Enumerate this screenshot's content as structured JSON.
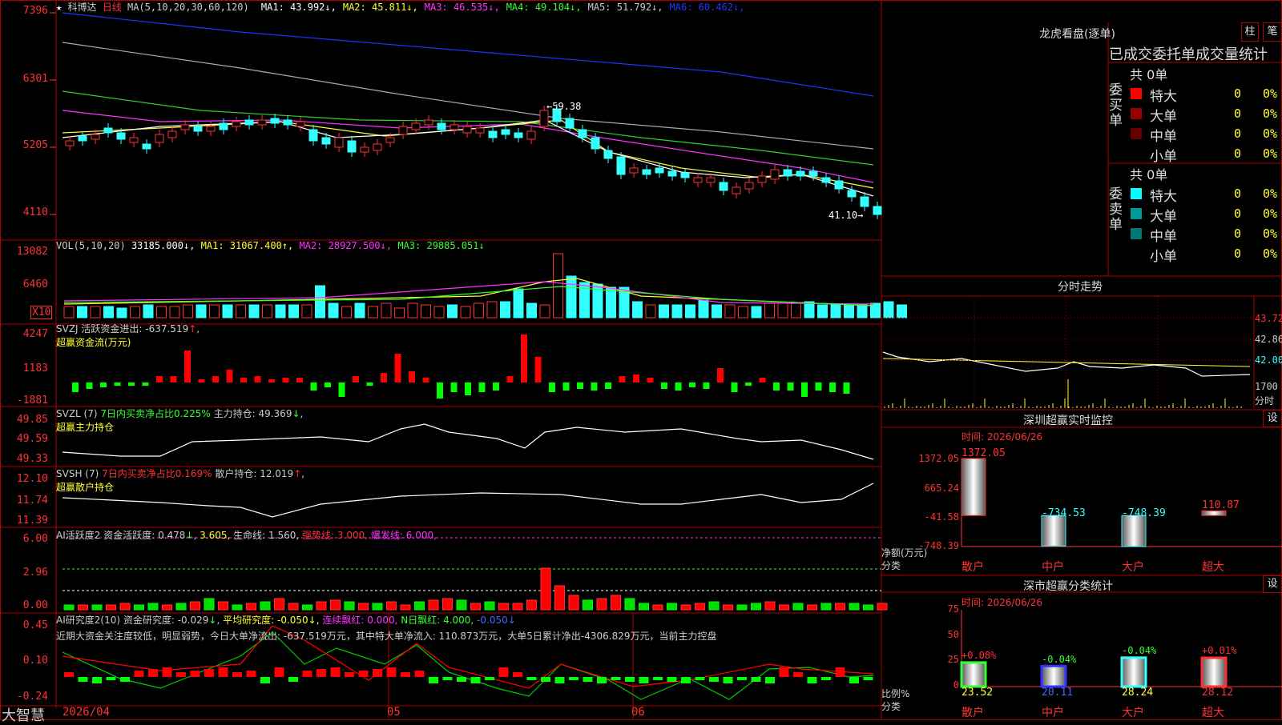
{
  "header": {
    "star": "★",
    "stock_name": "科博达",
    "period": "日线",
    "ma_label": "MA(5,10,20,30,60,120)",
    "ma": [
      {
        "label": "MA1:",
        "value": "43.992",
        "dir": "↓",
        "color": "#ffffff"
      },
      {
        "label": "MA2:",
        "value": "45.811",
        "dir": "↓",
        "color": "#ffff33"
      },
      {
        "label": "MA3:",
        "value": "46.535",
        "dir": "↓",
        "color": "#ff33ff"
      },
      {
        "label": "MA4:",
        "value": "49.104",
        "dir": "↓",
        "color": "#33ff33"
      },
      {
        "label": "MA5:",
        "value": "51.792",
        "dir": "↓",
        "color": "#cccccc"
      },
      {
        "label": "MA6:",
        "value": "60.462",
        "dir": "↓",
        "color": "#2233ff"
      }
    ]
  },
  "price_axis": [
    "7396",
    "6301",
    "5205",
    "4110"
  ],
  "price_annotations": {
    "high": "59.38",
    "low": "41.10"
  },
  "vol": {
    "header": "VOL(5,10,20)",
    "value": "33185.000",
    "ma1": "MA1: 31067.400",
    "ma2": "MA2: 28927.500",
    "ma3": "MA3: 29885.051",
    "axis": [
      "13082",
      "6460"
    ],
    "unit": "X10"
  },
  "svzj": {
    "line1": "SVZJ  活跃资金进出: -637.519",
    "line2": "超赢资金流(万元)",
    "axis": [
      "4247",
      "1183",
      "-1881"
    ]
  },
  "svzl": {
    "title": "SVZL (7)",
    "ratio": "7日内买卖净占比0.225%",
    "hold": "主力持仓: 49.369",
    "line2": "超赢主力持仓",
    "axis": [
      "49.85",
      "49.59",
      "49.33"
    ]
  },
  "svsh": {
    "title": "SVSH (7)",
    "ratio": "7日内买卖净占比0.169%",
    "hold": "散户持仓: 12.019",
    "line2": "超赢散户持仓",
    "axis": [
      "12.10",
      "11.74",
      "11.39"
    ]
  },
  "ai_active": {
    "title": "AI活跃度2",
    "fund": "资金活跃度: 0.478",
    "v2": "3.605",
    "life": "生命线: 1.560,",
    "strong": "强势线: 3.000,",
    "burst": "爆发线: 6.000,",
    "axis": [
      "6.00",
      "2.96",
      "0.00"
    ]
  },
  "ai_research": {
    "title": "AI研究度2(10)",
    "fund": "资金研究度: -0.029",
    "avg": "平均研究度: -0.050",
    "cont": "连续飘红: 0.000,",
    "nday": "N日飘红: 4.000,",
    "last": "-0.050",
    "comment": "近期大资金关注度较低，明显弱势，今日大单净流出: -637.519万元，其中特大单净流入: 110.873万元，大单5日累计净出-4306.829万元，当前主力控盘",
    "axis": [
      "0.45",
      "0.10",
      "-0.24"
    ]
  },
  "footer": {
    "brand": "大智慧",
    "dates": [
      "2026/04",
      "05",
      "06"
    ]
  },
  "right": {
    "lhkp_title": "龙虎看盘(逐单)",
    "btn_zhu": "柱",
    "btn_bi": "笔",
    "tabs": "已成交委托单成交量统计",
    "buy": {
      "label": "委买单",
      "total": "共 0单",
      "rows": [
        {
          "name": "特大",
          "count": "0",
          "pct": "0%",
          "color": "#ff0000"
        },
        {
          "name": "大单",
          "count": "0",
          "pct": "0%",
          "color": "#990000"
        },
        {
          "name": "中单",
          "count": "0",
          "pct": "0%",
          "color": "#660000"
        },
        {
          "name": "小单",
          "count": "0",
          "pct": "0%",
          "color": ""
        }
      ]
    },
    "sell": {
      "label": "委卖单",
      "total": "共 0单",
      "rows": [
        {
          "name": "特大",
          "count": "0",
          "pct": "0%",
          "color": "#00ffff"
        },
        {
          "name": "大单",
          "count": "0",
          "pct": "0%",
          "color": "#009999"
        },
        {
          "name": "中单",
          "count": "0",
          "pct": "0%",
          "color": "#007777"
        },
        {
          "name": "小单",
          "count": "0",
          "pct": "0%",
          "color": ""
        }
      ]
    },
    "fenshi_title": "分时走势",
    "fenshi_axis": [
      "43.72",
      "42.86",
      "42.00",
      "1700"
    ],
    "fenshi_unit": "分时",
    "monitor": {
      "title": "深圳超赢实时监控",
      "btn": "设",
      "time": "时间: 2026/06/26",
      "axis": [
        "1372.05",
        "665.24",
        "-41.58",
        "-748.39"
      ],
      "ylabel": "净额(万元)",
      "xlabel": "分类",
      "bars": [
        {
          "cat": "散户",
          "value": "1372.05"
        },
        {
          "cat": "中户",
          "value": "-734.53"
        },
        {
          "cat": "大户",
          "value": "-748.39"
        },
        {
          "cat": "超大",
          "value": "110.87"
        }
      ]
    },
    "classify": {
      "title": "深市超赢分类统计",
      "btn": "设",
      "time": "时间: 2026/06/26",
      "axis": [
        "75",
        "50",
        "25",
        "0"
      ],
      "ylabel": "比例%",
      "xlabel": "分类",
      "bars": [
        {
          "cat": "散户",
          "value": "23.52",
          "change": "+0.08%"
        },
        {
          "cat": "中户",
          "value": "20.11",
          "change": "-0.04%"
        },
        {
          "cat": "大户",
          "value": "28.24",
          "change": "-0.04%"
        },
        {
          "cat": "超大",
          "value": "28.12",
          "change": "+0.01%"
        }
      ]
    }
  },
  "chart_data": [
    {
      "type": "candlestick",
      "title": "科博达 日线",
      "x": [
        "2026/04",
        "05",
        "06"
      ],
      "ylim": [
        41.1,
        73.96
      ],
      "ma": {
        "MA1": 43.992,
        "MA2": 45.811,
        "MA3": 46.535,
        "MA4": 49.104,
        "MA5": 51.792,
        "MA6": 60.462
      },
      "high": 59.38,
      "low": 41.1
    },
    {
      "type": "bar",
      "title": "深圳超赢实时监控",
      "categories": [
        "散户",
        "中户",
        "大户",
        "超大"
      ],
      "values": [
        1372.05,
        -734.53,
        -748.39,
        110.87
      ],
      "ylabel": "净额(万元)",
      "xlabel": "分类"
    },
    {
      "type": "bar",
      "title": "深市超赢分类统计",
      "categories": [
        "散户",
        "中户",
        "大户",
        "超大"
      ],
      "values": [
        23.52,
        20.11,
        28.24,
        28.12
      ],
      "changes": [
        "+0.08%",
        "-0.04%",
        "-0.04%",
        "+0.01%"
      ],
      "ylabel": "比例%",
      "xlabel": "分类",
      "ylim": [
        0,
        75
      ]
    }
  ]
}
